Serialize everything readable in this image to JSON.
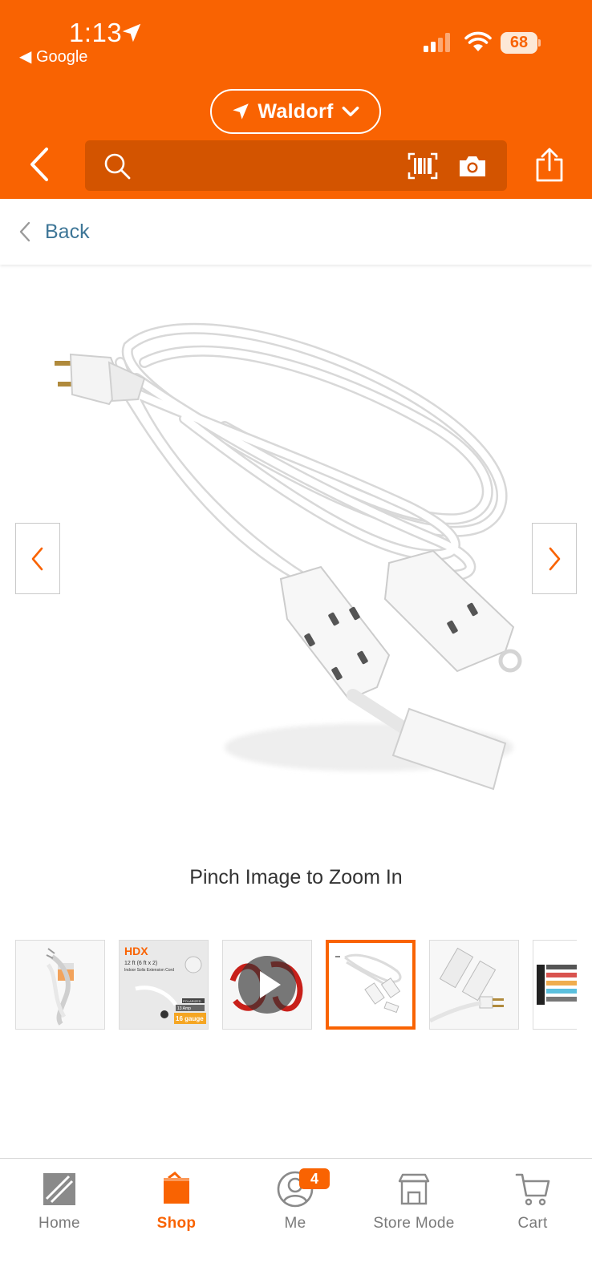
{
  "status_bar": {
    "time": "1:13",
    "back_app": "◀ Google",
    "battery": "68"
  },
  "header": {
    "store_name": "Waldorf",
    "search_placeholder": ""
  },
  "back_row": {
    "label": "Back"
  },
  "product": {
    "zoom_hint": "Pinch Image to Zoom In",
    "thumbnails": [
      {
        "kind": "packaged-cord"
      },
      {
        "kind": "package-front",
        "brand": "HDX",
        "line1": "12 ft (6 ft x 2)",
        "line2": "Indoor Solis Extension Cord",
        "amp": "13 Amp",
        "gauge": "16 gauge",
        "tag": "POLARIZED"
      },
      {
        "kind": "video"
      },
      {
        "kind": "product-photo",
        "selected": true
      },
      {
        "kind": "closeup"
      },
      {
        "kind": "spec-chart"
      }
    ]
  },
  "tabbar": {
    "tabs": [
      {
        "label": "Home",
        "active": false
      },
      {
        "label": "Shop",
        "active": true
      },
      {
        "label": "Me",
        "active": false,
        "badge": "4"
      },
      {
        "label": "Store Mode",
        "active": false
      },
      {
        "label": "Cart",
        "active": false
      }
    ]
  },
  "colors": {
    "brand_orange": "#f96302",
    "search_bg": "#d35400",
    "link_blue": "#3e7697",
    "tab_inactive": "#7a7a7a"
  }
}
